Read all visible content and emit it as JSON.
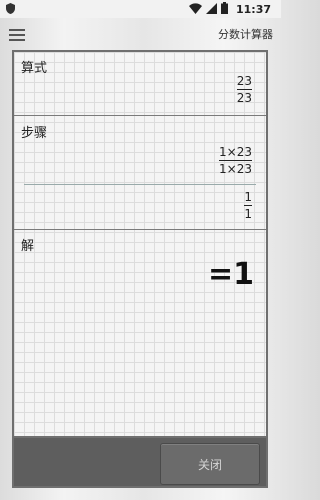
{
  "status_bar": {
    "time": "11:37",
    "icons": [
      "shield-icon",
      "wifi-icon",
      "signal-icon",
      "battery-icon"
    ]
  },
  "app_bar": {
    "menu_icon": "hamburger-icon",
    "title": "分数计算器"
  },
  "expression": {
    "label": "算式",
    "numerator": "23",
    "denominator": "23"
  },
  "steps": {
    "label": "步骤",
    "items": [
      {
        "numerator": "1×23",
        "denominator": "1×23"
      },
      {
        "numerator": "1",
        "denominator": "1"
      }
    ]
  },
  "solution": {
    "label": "解",
    "result": "=1"
  },
  "bottom_bar": {
    "close_label": "关闭"
  }
}
